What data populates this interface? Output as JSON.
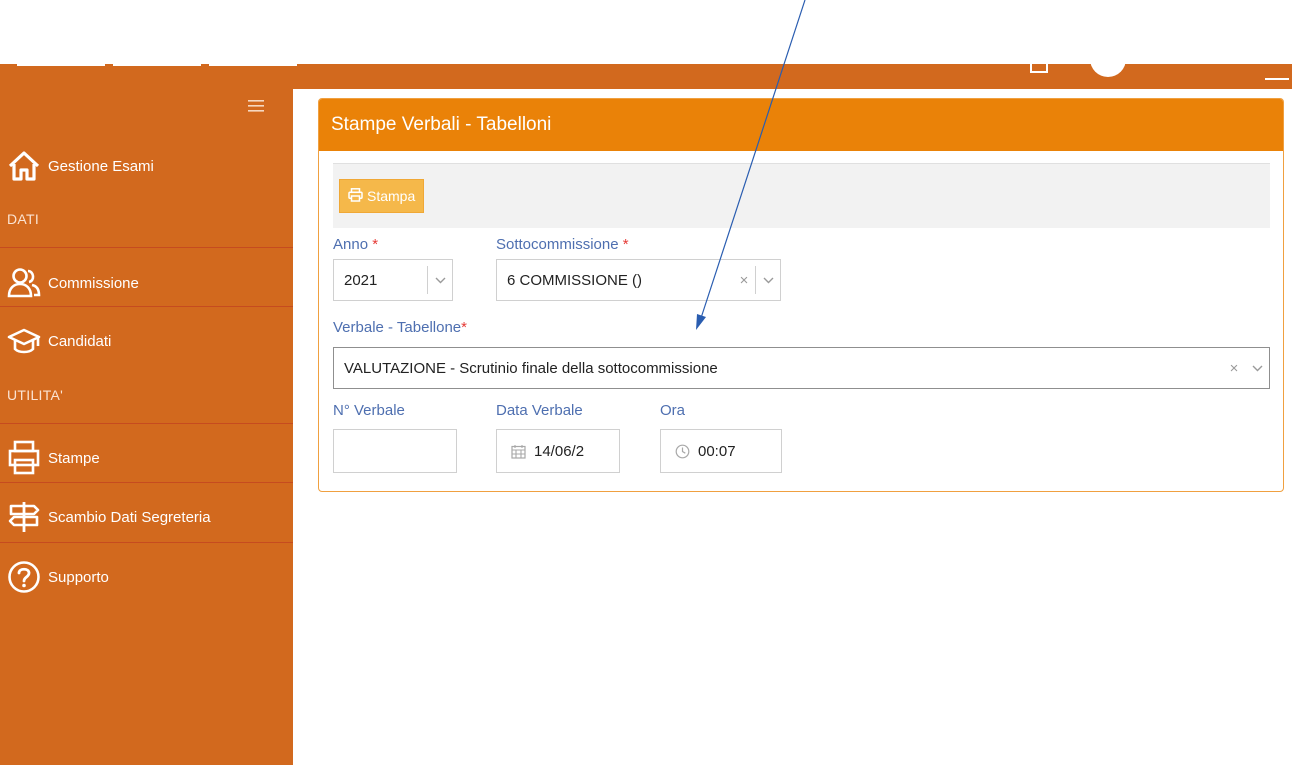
{
  "sidebar": {
    "items": [
      {
        "label": "Gestione Esami",
        "icon": "home-icon"
      },
      {
        "label": "Commissione",
        "icon": "users-icon"
      },
      {
        "label": "Candidati",
        "icon": "graduation-cap-icon"
      },
      {
        "label": "Stampe",
        "icon": "printer-icon"
      },
      {
        "label": "Scambio Dati Segreteria",
        "icon": "signpost-icon"
      },
      {
        "label": "Supporto",
        "icon": "help-icon"
      }
    ],
    "sections": {
      "dati": "DATI",
      "utilita": "UTILITA'"
    }
  },
  "panel": {
    "title": "Stampe Verbali - Tabelloni",
    "print_button": "Stampa"
  },
  "form": {
    "anno": {
      "label": "Anno",
      "required": "*",
      "value": "2021"
    },
    "sottocommissione": {
      "label": "Sottocommissione",
      "required": "*",
      "value": "6 COMMISSIONE ()"
    },
    "verbale_tabellone": {
      "label": "Verbale - Tabellone",
      "required": "*",
      "value": "VALUTAZIONE - Scrutinio finale della sottocommissione"
    },
    "numero_verbale": {
      "label": "N° Verbale",
      "value": ""
    },
    "data_verbale": {
      "label": "Data Verbale",
      "value": "14/06/2"
    },
    "ora": {
      "label": "Ora",
      "value": "00:07"
    }
  },
  "colors": {
    "sidebar": "#d2691e",
    "panel_header": "#ea8208",
    "button": "#f5b84a",
    "label": "#4e6fb0",
    "annotation_arrow": "#2a5db0"
  }
}
